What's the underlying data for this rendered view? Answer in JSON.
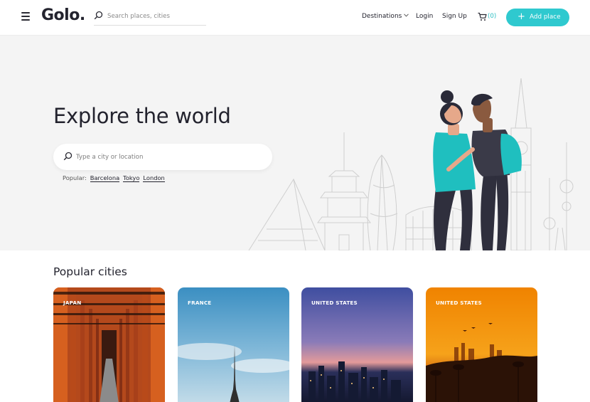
{
  "header": {
    "logo": "Golo.",
    "search_placeholder": "Search places, cities",
    "nav": {
      "destinations": "Destinations",
      "login": "Login",
      "signup": "Sign Up"
    },
    "cart_count": "(0)",
    "add_place_label": "Add place"
  },
  "hero": {
    "title": "Explore the world",
    "search_placeholder": "Type a city or location",
    "popular_label": "Popular:",
    "popular_links": [
      "Barcelona",
      "Tokyo",
      "London"
    ]
  },
  "section": {
    "title": "Popular cities"
  },
  "cities": [
    {
      "country": "JAPAN"
    },
    {
      "country": "FRANCE"
    },
    {
      "country": "UNITED STATES"
    },
    {
      "country": "UNITED STATES"
    }
  ],
  "colors": {
    "accent": "#2fc9cf",
    "text": "#23232e",
    "hero_bg": "#f4f4f4"
  }
}
